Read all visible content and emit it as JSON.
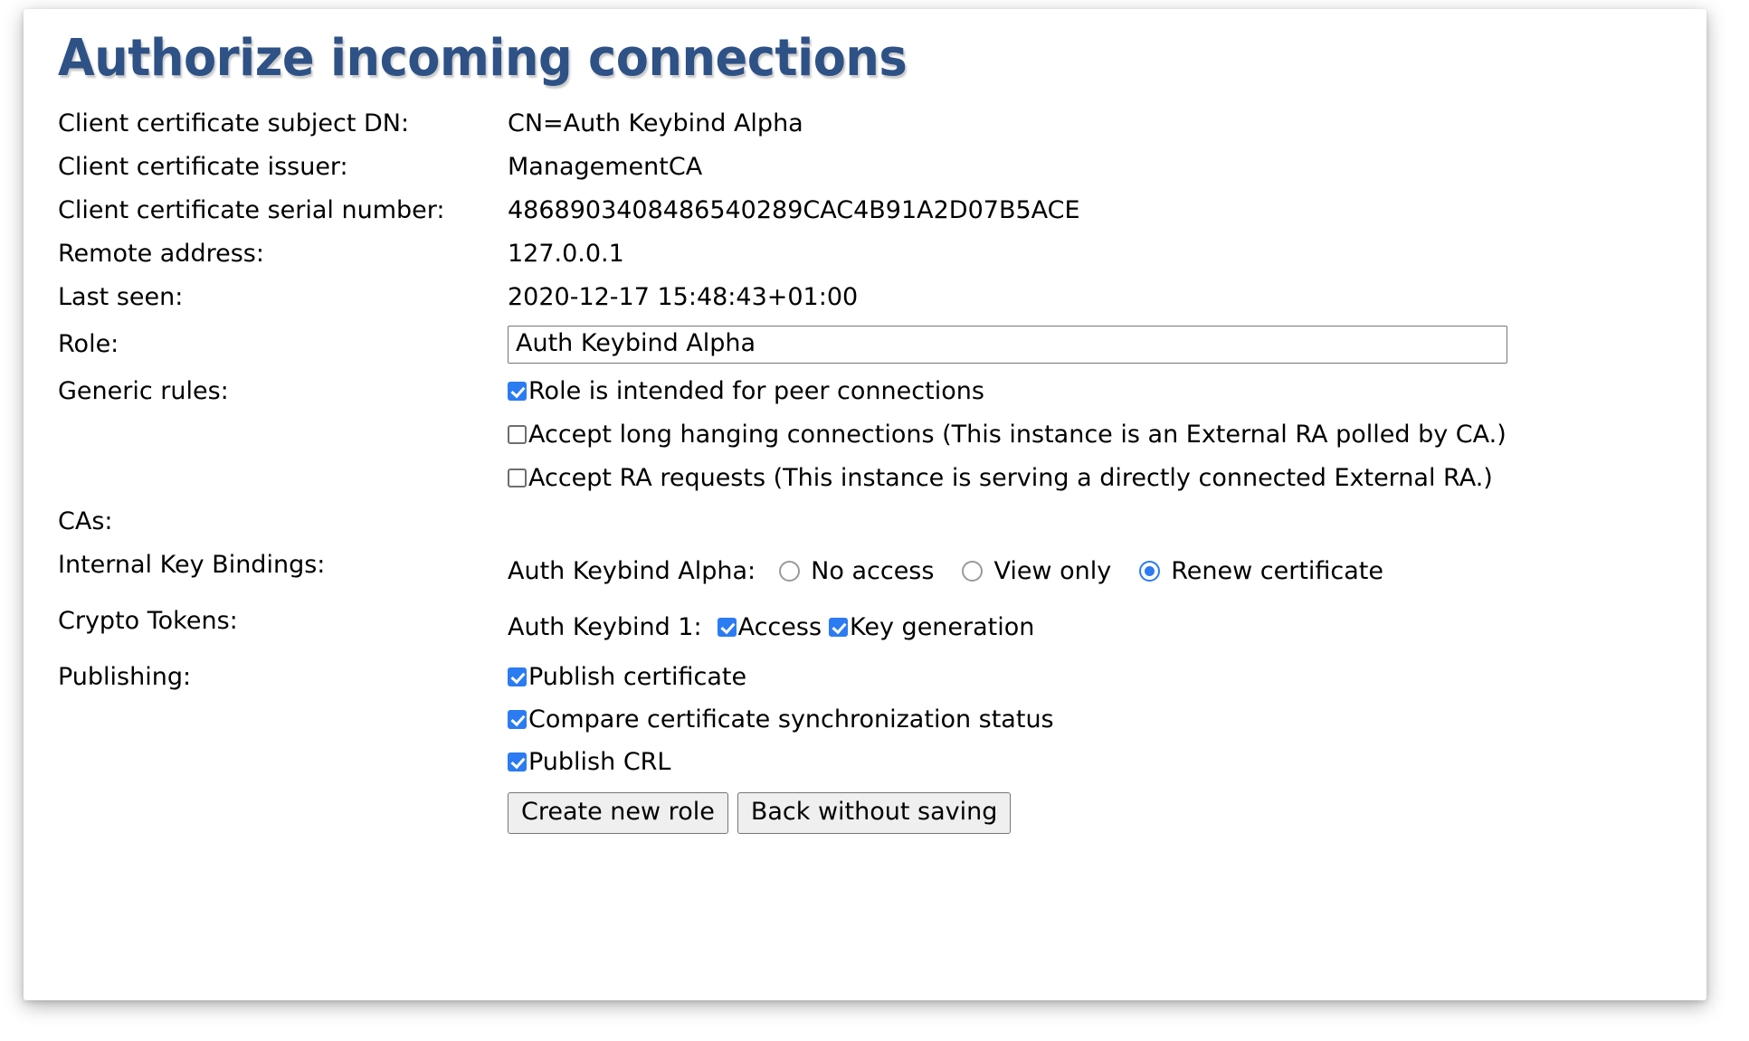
{
  "page": {
    "title": "Authorize incoming connections"
  },
  "details": {
    "subject_dn_label": "Client certificate subject DN:",
    "subject_dn_value": "CN=Auth Keybind Alpha",
    "issuer_label": "Client certificate issuer:",
    "issuer_value": "ManagementCA",
    "serial_label": "Client certificate serial number:",
    "serial_value": "4868903408486540289CAC4B91A2D07B5ACE",
    "remote_address_label": "Remote address:",
    "remote_address_value": "127.0.0.1",
    "last_seen_label": "Last seen:",
    "last_seen_value": "2020-12-17 15:48:43+01:00"
  },
  "role": {
    "label": "Role:",
    "value": "Auth Keybind Alpha",
    "placeholder": ""
  },
  "generic_rules": {
    "label": "Generic rules:",
    "items": [
      {
        "label": "Role is intended for peer connections",
        "checked": true
      },
      {
        "label": "Accept long hanging connections (This instance is an External RA polled by CA.)",
        "checked": false
      },
      {
        "label": "Accept RA requests (This instance is serving a directly connected External RA.)",
        "checked": false
      }
    ]
  },
  "cas": {
    "label": "CAs:"
  },
  "internal_key_bindings": {
    "label": "Internal Key Bindings:",
    "entry_name": "Auth Keybind Alpha:",
    "options": [
      {
        "label": "No access",
        "selected": false
      },
      {
        "label": "View only",
        "selected": false
      },
      {
        "label": "Renew certificate",
        "selected": true
      }
    ]
  },
  "crypto_tokens": {
    "label": "Crypto Tokens:",
    "entry_name": "Auth Keybind 1:",
    "options": [
      {
        "label": "Access",
        "checked": true
      },
      {
        "label": "Key generation",
        "checked": true
      }
    ]
  },
  "publishing": {
    "label": "Publishing:",
    "items": [
      {
        "label": "Publish certificate",
        "checked": true
      },
      {
        "label": "Compare certificate synchronization status",
        "checked": true
      },
      {
        "label": "Publish CRL",
        "checked": true
      }
    ]
  },
  "buttons": {
    "create": "Create new role",
    "back": "Back without saving"
  },
  "colors": {
    "title": "#2e5186",
    "accent": "#2b7bf3",
    "button_bg": "#efefef",
    "border": "#767676"
  }
}
